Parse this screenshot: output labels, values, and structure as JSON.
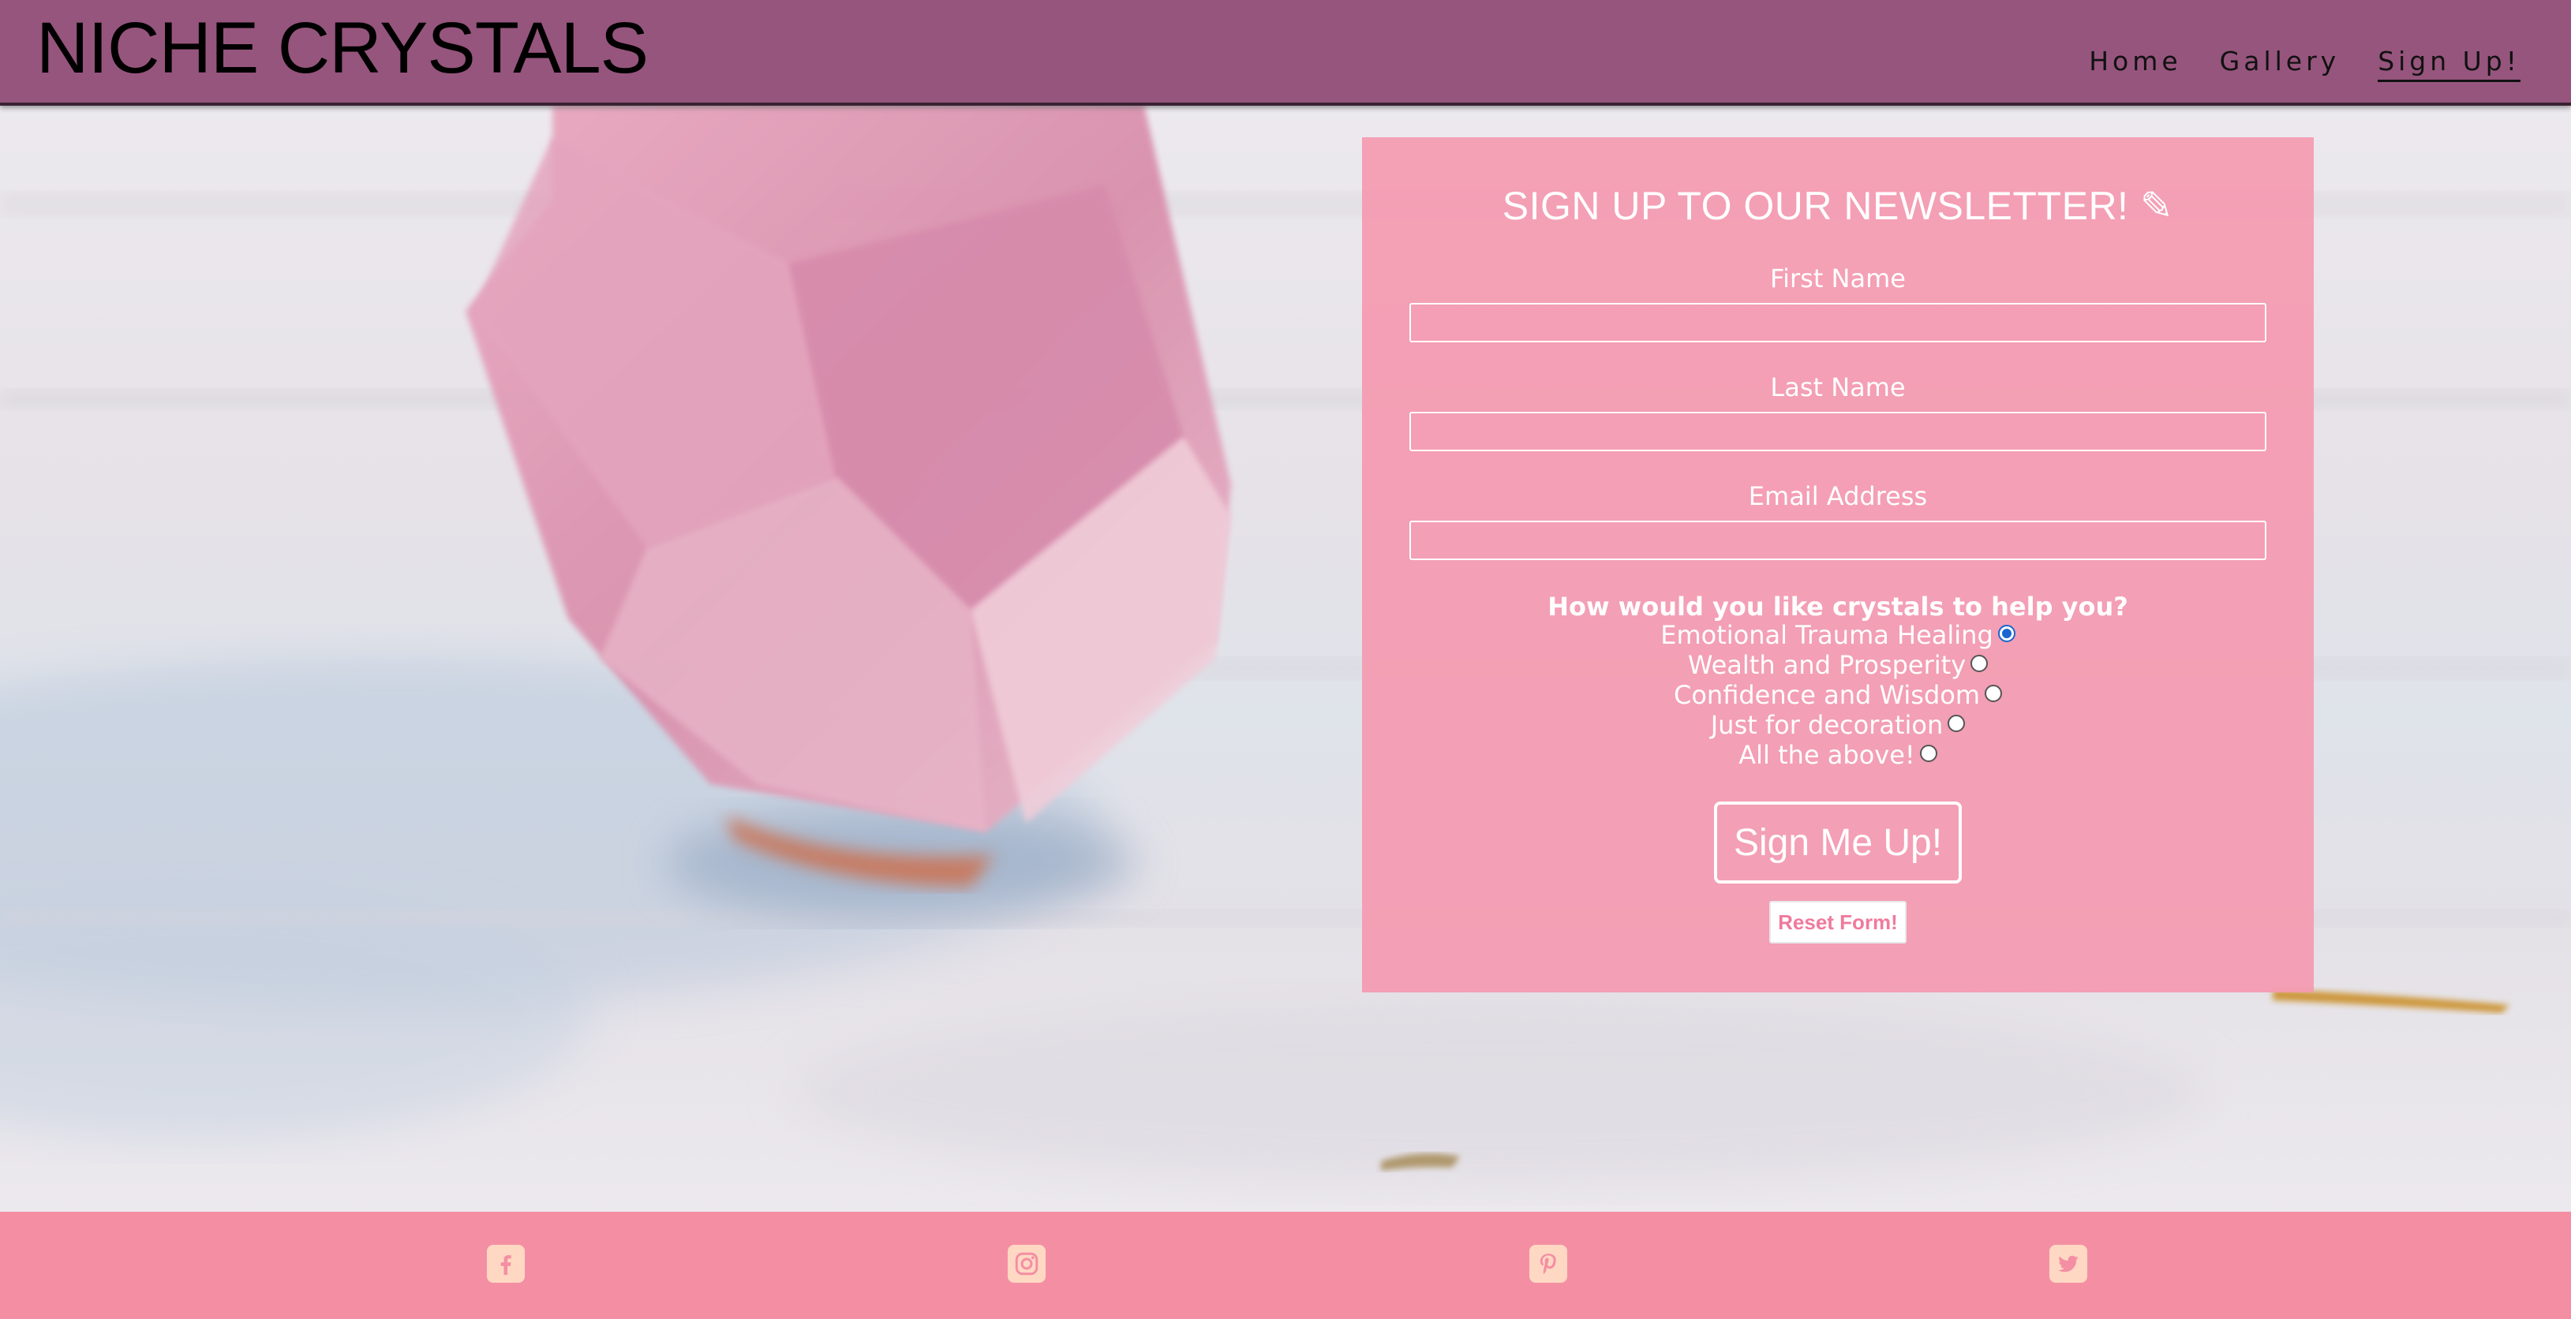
{
  "site": {
    "logo": "NICHE CRYSTALS"
  },
  "nav": {
    "items": [
      {
        "label": "Home",
        "active": false
      },
      {
        "label": "Gallery",
        "active": false
      },
      {
        "label": "Sign Up!",
        "active": true
      }
    ]
  },
  "form": {
    "title": "SIGN UP TO OUR NEWSLETTER! ✎",
    "fields": [
      {
        "label": "First Name",
        "value": ""
      },
      {
        "label": "Last Name",
        "value": ""
      },
      {
        "label": "Email Address",
        "value": ""
      }
    ],
    "question": "How would you like crystals to help you?",
    "options": [
      {
        "label": "Emotional Trauma Healing",
        "checked": true
      },
      {
        "label": "Wealth and Prosperity",
        "checked": false
      },
      {
        "label": "Confidence and Wisdom",
        "checked": false
      },
      {
        "label": "Just for decoration",
        "checked": false
      },
      {
        "label": "All the above!",
        "checked": false
      }
    ],
    "submit_label": "Sign Me Up!",
    "reset_label": "Reset Form!"
  },
  "footer": {
    "social_icons": [
      "facebook-icon",
      "instagram-icon",
      "pinterest-icon",
      "twitter-icon"
    ]
  },
  "colors": {
    "header_bg": "#96557d",
    "form_bg": "#f49ab0",
    "footer_bg": "#f48fa3",
    "icon_color": "#ffd8c4",
    "radio_checked": "#1a66d0"
  }
}
